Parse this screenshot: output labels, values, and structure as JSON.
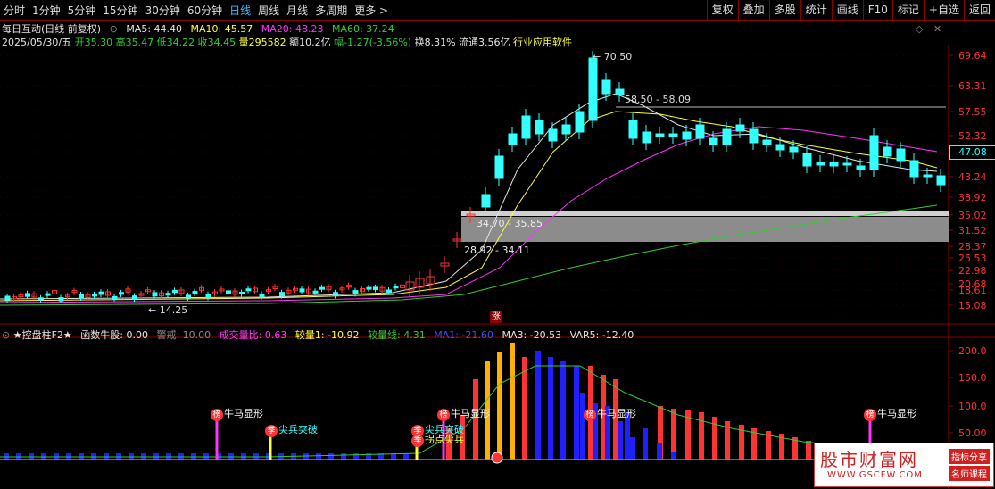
{
  "tabs": [
    {
      "label": "分时"
    },
    {
      "label": "1分钟"
    },
    {
      "label": "5分钟"
    },
    {
      "label": "15分钟"
    },
    {
      "label": "30分钟"
    },
    {
      "label": "60分钟"
    },
    {
      "label": "日线",
      "active": true
    },
    {
      "label": "周线"
    },
    {
      "label": "月线"
    },
    {
      "label": "多周期"
    },
    {
      "label": "更多 >"
    }
  ],
  "tools": [
    "复权",
    "叠加",
    "多股",
    "统计",
    "画线",
    "F10",
    "标记",
    "+自选",
    "返回"
  ],
  "stock": {
    "title": "每日互动(日线 前复权)",
    "ma5": "MA5: 44.40",
    "ma10": "MA10: 45.57",
    "ma20": "MA20: 48.23",
    "ma60": "MA60: 37.24",
    "date": "2025/05/30/五",
    "open": "开35.30",
    "high": "高35.47",
    "low": "低34.22",
    "close": "收34.45",
    "volume": "量295582",
    "amount": "额10.2亿",
    "change": "幅-1.27(-3.56%)",
    "turnover": "换8.31%",
    "float": "流通3.56亿",
    "industry": "行业应用软件"
  },
  "colors": {
    "up": "#ff3333",
    "down": "#33ffff",
    "ma5": "#e6e6e6",
    "ma10": "#ffff33",
    "ma20": "#ff33ff",
    "ma60": "#33cc33",
    "border": "#8b0000",
    "axis": "#ff3333"
  },
  "price_axis": {
    "ticks": [
      "69.64",
      "63.31",
      "57.55",
      "52.32",
      "47.56",
      "43.24",
      "38.92",
      "35.02",
      "31.52",
      "28.37",
      "25.53",
      "22.98",
      "20.68",
      "18.61",
      "15.08"
    ],
    "current": "47.08"
  },
  "annotations": {
    "high": "70.50",
    "low": "14.25",
    "zone_upper": "58.50 - 58.09",
    "zone_mid": "34.70 - 35.85",
    "zone_low": "28.92 - 34.11",
    "limit_badge": "涨"
  },
  "indicator": {
    "name": "★控盘柱F2★",
    "fn": "函数牛股: 0.00",
    "warn": "警戒: 10.00",
    "vol_ratio": "成交量比: 0.63",
    "vol1": "较量1: -10.92",
    "volline": "较量线: 4.31",
    "ma1": "MA1: -21.60",
    "ma3": "MA3: -20.53",
    "var5": "VAR5: -12.40",
    "axis": [
      "200.0",
      "150.0",
      "100.0",
      "50.00"
    ],
    "signals": {
      "niu": "牛马显形",
      "jian": "尖兵突破",
      "guai": "拐点尖兵",
      "bang": "榜",
      "ji": "季"
    }
  },
  "watermark": {
    "name": "股市财富网",
    "url": "WWW.GSCFW.COM",
    "badge1": "指标分享",
    "badge2": "名师课程"
  }
}
